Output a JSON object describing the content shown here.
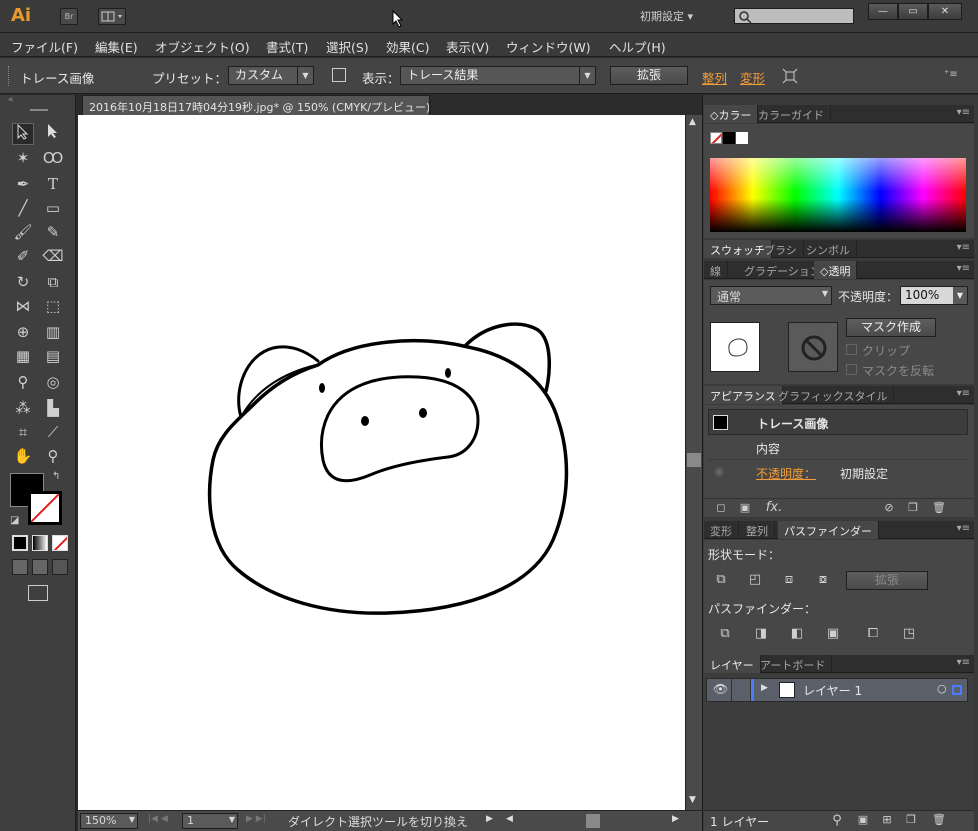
{
  "app": {
    "logo": "Ai",
    "workspace": "初期設定",
    "bridge_label": "Br"
  },
  "menu": [
    "ファイル(F)",
    "編集(E)",
    "オブジェクト(O)",
    "書式(T)",
    "選択(S)",
    "効果(C)",
    "表示(V)",
    "ウィンドウ(W)",
    "ヘルプ(H)"
  ],
  "control": {
    "object_type": "トレース画像",
    "preset_label": "プリセット：",
    "preset_value": "カスタム",
    "view_label": "表示：",
    "view_value": "トレース結果",
    "expand_button": "拡張",
    "align_link": "整列",
    "transform_link": "変形"
  },
  "document": {
    "tab_title": "2016年10月18日17時04分19秒.jpg* @ 150% (CMYK/プレビュー)",
    "close": "×"
  },
  "status": {
    "zoom": "150%",
    "artboard": "1",
    "message": "ダイレクト選択ツールを切り換え"
  },
  "panels": {
    "color": {
      "tabs": [
        "カラー",
        "カラーガイド"
      ]
    },
    "swatch": {
      "tabs": [
        "スウォッチ",
        "ブラシ",
        "シンボル"
      ]
    },
    "transparency": {
      "tabs": [
        "線",
        "グラデーション",
        "透明"
      ],
      "blend_mode": "通常",
      "opacity_label": "不透明度：",
      "opacity_value": "100%",
      "make_mask": "マスク作成",
      "clip": "クリップ",
      "invert_mask": "マスクを反転"
    },
    "appearance": {
      "tabs": [
        "アピアランス",
        "グラフィックスタイル"
      ],
      "object_name": "トレース画像",
      "contents": "内容",
      "opacity_link": "不透明度：",
      "opacity_value": "初期設定",
      "fx_label": "fx."
    },
    "pathfinder": {
      "tabs": [
        "変形",
        "整列",
        "パスファインダー"
      ],
      "shape_modes": "形状モード：",
      "expand": "拡張",
      "pathfinders": "パスファインダー："
    },
    "layers": {
      "tabs": [
        "レイヤー",
        "アートボード"
      ],
      "layer_name": "レイヤー 1",
      "footer": "1 レイヤー"
    }
  },
  "colors": {
    "accent_orange": "#f29d38",
    "panel_bg": "#474747",
    "canvas_bg": "#ffffff"
  }
}
